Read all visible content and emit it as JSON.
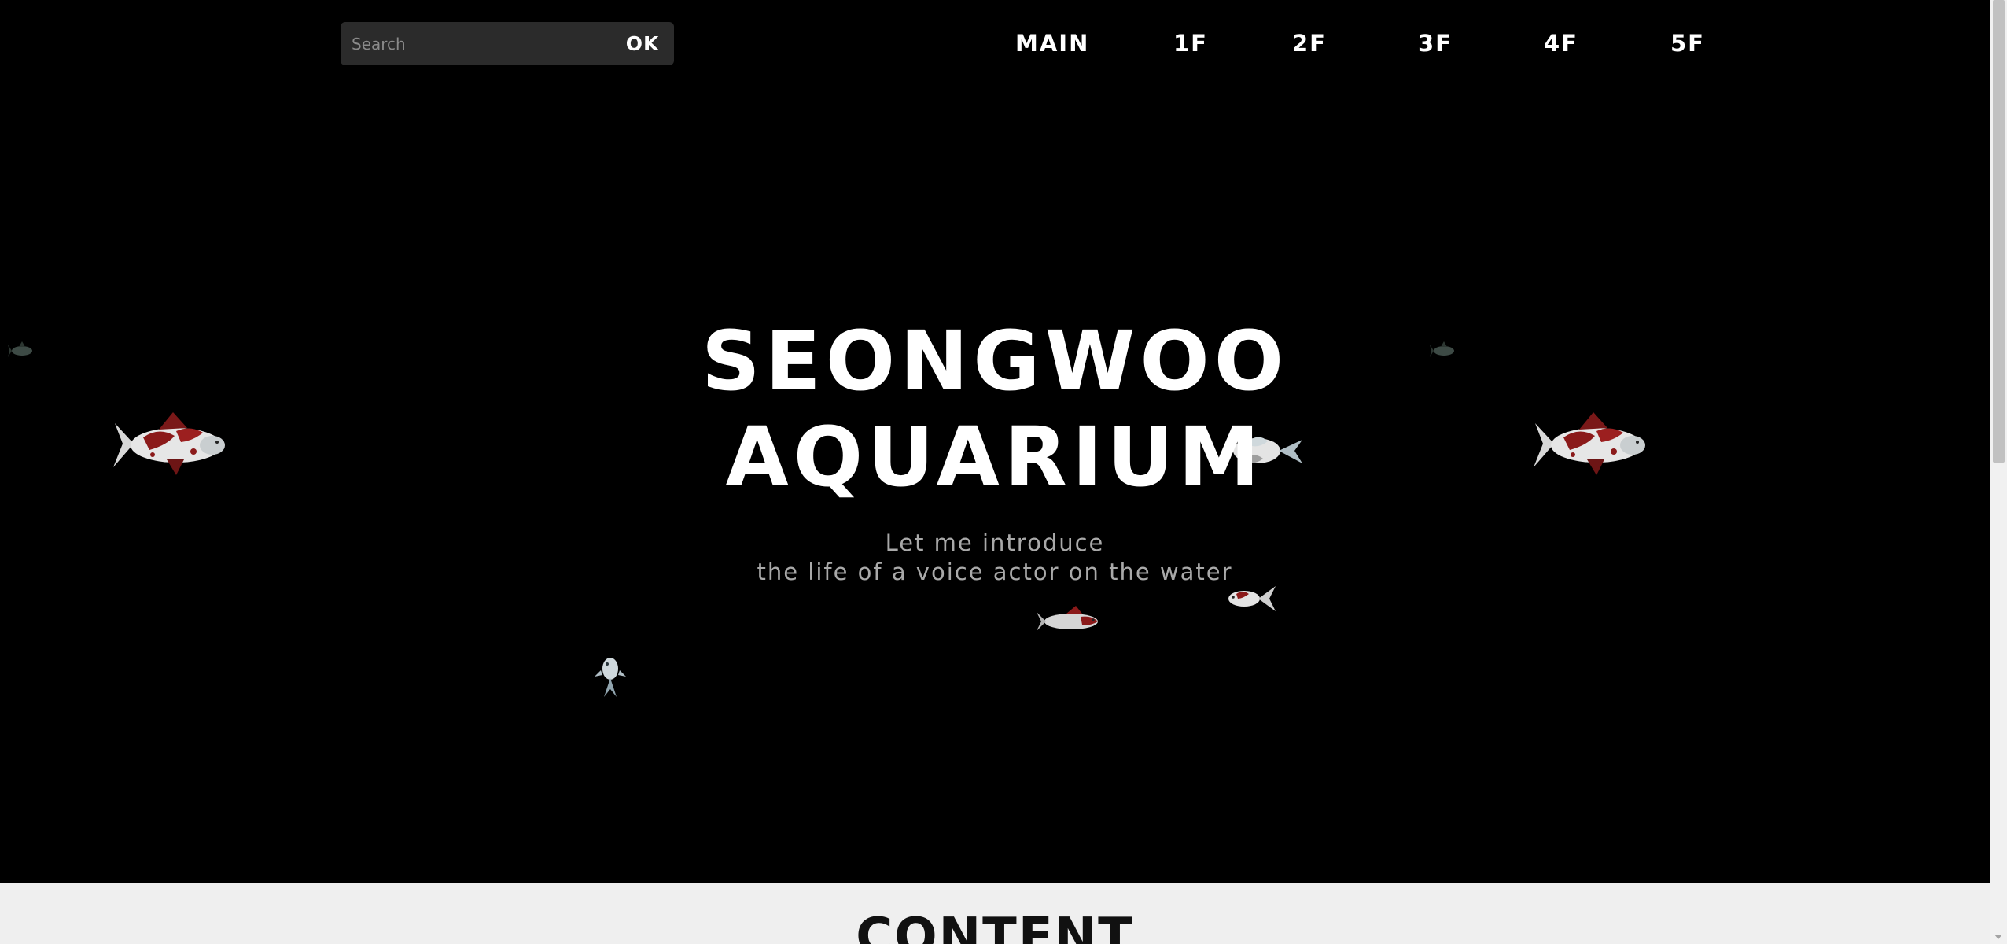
{
  "search": {
    "placeholder": "Search",
    "value": "",
    "button_label": "OK"
  },
  "nav": {
    "items": [
      {
        "label": "MAIN"
      },
      {
        "label": "1F"
      },
      {
        "label": "2F"
      },
      {
        "label": "3F"
      },
      {
        "label": "4F"
      },
      {
        "label": "5F"
      }
    ]
  },
  "hero": {
    "title_line1": "SEONGWOO",
    "title_line2": "AQUARIUM",
    "subtitle_line1": "Let me introduce",
    "subtitle_line2": "the life of a voice actor on the water"
  },
  "content": {
    "heading": "CONTENT"
  },
  "colors": {
    "background": "#000000",
    "text": "#ffffff",
    "subtitle": "#a9a9a9",
    "search_bg": "#2b2b2b",
    "content_bg": "#efefef",
    "koi_red": "#8b1a1a"
  },
  "icons": {
    "fish": "koi-fish-icon",
    "scroll_down": "chevron-down-icon"
  }
}
